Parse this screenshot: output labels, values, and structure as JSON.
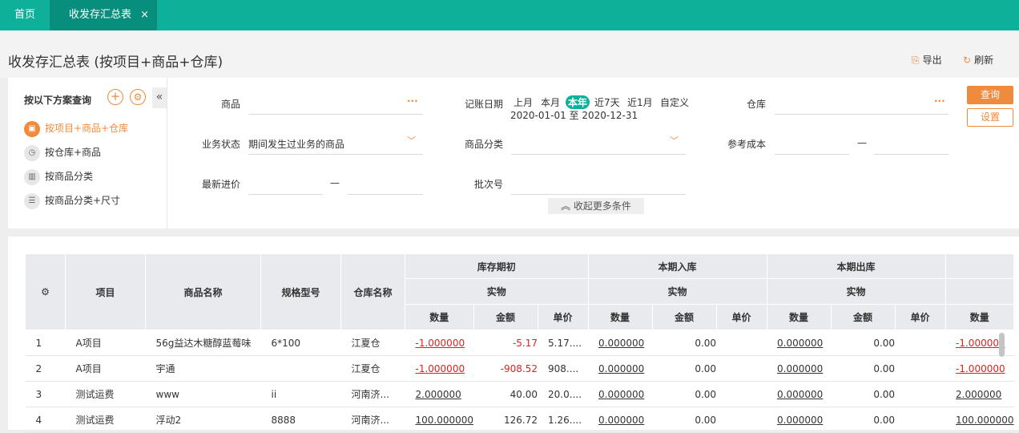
{
  "tabs": {
    "home": "首页",
    "active": "收发存汇总表",
    "close": "×"
  },
  "header": {
    "title": "收发存汇总表 (按项目+商品+仓库)",
    "export": "导出",
    "refresh": "刷新"
  },
  "plan": {
    "title": "按以下方案查询",
    "items": [
      {
        "label": "按项目+商品+仓库",
        "icon": "box-icon"
      },
      {
        "label": "按仓库+商品",
        "icon": "clock-icon"
      },
      {
        "label": "按商品分类",
        "icon": "chart-icon"
      },
      {
        "label": "按商品分类+尺寸",
        "icon": "list-icon"
      }
    ]
  },
  "filters": {
    "goods": "商品",
    "date_label": "记账日期",
    "periods": [
      "上月",
      "本月",
      "本年",
      "近7天",
      "近1月",
      "自定义"
    ],
    "date_range": "2020-01-01 至 2020-12-31",
    "warehouse": "仓库",
    "biz_status": "业务状态",
    "biz_status_value": "期间发生过业务的商品",
    "goods_category": "商品分类",
    "ref_cost": "参考成本",
    "latest_price": "最新进价",
    "batch_no": "批次号",
    "dash": "—",
    "dots": "···",
    "query": "查询",
    "settings": "设置",
    "more": "收起更多条件"
  },
  "table": {
    "headers": [
      "项目",
      "商品名称",
      "规格型号",
      "仓库名称"
    ],
    "groups": [
      "库存期初",
      "本期入库",
      "本期出库"
    ],
    "sub": "实物",
    "cols": [
      "数量",
      "金额",
      "单价"
    ],
    "rows": [
      {
        "no": "1",
        "project": "A项目",
        "name": "56g益达木糖醇蓝莓味",
        "spec": "6*100",
        "wh": "江夏仓",
        "oq": "-1.000000",
        "oa": "-5.17",
        "op": "5.17....",
        "iq": "0.000000",
        "ia": "0.00",
        "ip": "",
        "xq": "0.000000",
        "xa": "0.00",
        "xp": "",
        "eq": "-1.000000"
      },
      {
        "no": "2",
        "project": "A项目",
        "name": "宇通",
        "spec": "",
        "wh": "江夏仓",
        "oq": "-1.000000",
        "oa": "-908.52",
        "op": "908....",
        "iq": "0.000000",
        "ia": "0.00",
        "ip": "",
        "xq": "0.000000",
        "xa": "0.00",
        "xp": "",
        "eq": "-1.000000"
      },
      {
        "no": "3",
        "project": "测试运费",
        "name": "www",
        "spec": "ii",
        "wh": "河南济...",
        "oq": "2.000000",
        "oa": "40.00",
        "op": "20.0....",
        "iq": "0.000000",
        "ia": "0.00",
        "ip": "",
        "xq": "0.000000",
        "xa": "0.00",
        "xp": "",
        "eq": "2.000000"
      },
      {
        "no": "4",
        "project": "测试运费",
        "name": "浮动2",
        "spec": "8888",
        "wh": "河南济...",
        "oq": "100.000000",
        "oa": "126.72",
        "op": "1.26....",
        "iq": "0.000000",
        "ia": "0.00",
        "ip": "",
        "xq": "0.000000",
        "xa": "0.00",
        "xp": "",
        "eq": "100.000000"
      }
    ]
  },
  "colors": {
    "teal": "#0fb09a",
    "teal_dark": "#088e7d",
    "orange": "#f08a3c",
    "red": "#e02020"
  }
}
